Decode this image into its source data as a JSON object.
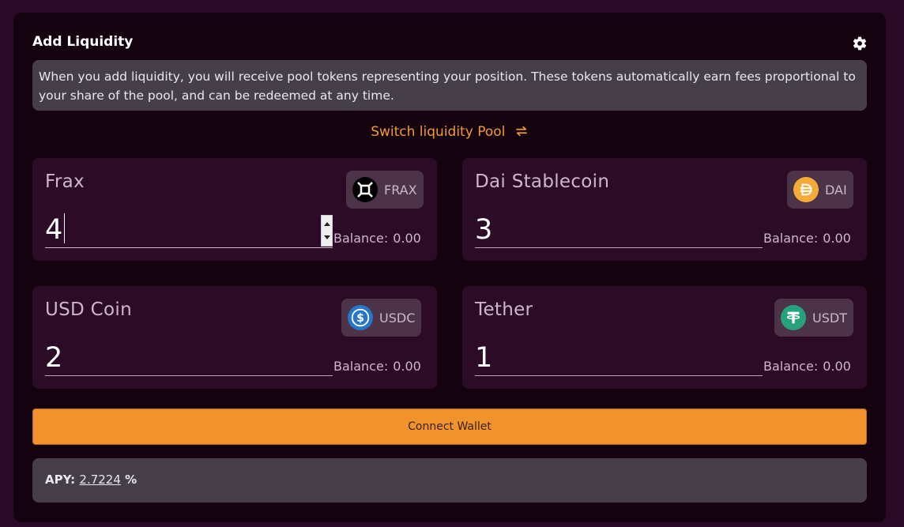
{
  "header": {
    "title": "Add Liquidity",
    "settings_icon": "gear-icon"
  },
  "info": {
    "text": "When you add liquidity, you will receive pool tokens representing your position. These tokens automatically earn fees proportional to your share of the pool, and can be redeemed at any time."
  },
  "switch_pool": {
    "label": "Switch liquidity Pool",
    "icon": "swap-arrows-icon"
  },
  "tokens": [
    {
      "name": "Frax",
      "symbol": "FRAX",
      "amount": "4",
      "balance_label": "Balance:",
      "balance": "0.00",
      "icon": "frax-icon",
      "color": "#000000"
    },
    {
      "name": "Dai Stablecoin",
      "symbol": "DAI",
      "amount": "3",
      "balance_label": "Balance:",
      "balance": "0.00",
      "icon": "dai-icon",
      "color": "#f5ac37"
    },
    {
      "name": "USD Coin",
      "symbol": "USDC",
      "amount": "2",
      "balance_label": "Balance:",
      "balance": "0.00",
      "icon": "usdc-icon",
      "color": "#2775ca"
    },
    {
      "name": "Tether",
      "symbol": "USDT",
      "amount": "1",
      "balance_label": "Balance:",
      "balance": "0.00",
      "icon": "usdt-icon",
      "color": "#26a17b"
    }
  ],
  "connect_button": {
    "label": "Connect Wallet"
  },
  "apy": {
    "label": "APY:",
    "value": "2.7224",
    "unit": "%"
  },
  "colors": {
    "accent": "#f0932d",
    "background": "#14030f",
    "card": "#2c0b27"
  }
}
